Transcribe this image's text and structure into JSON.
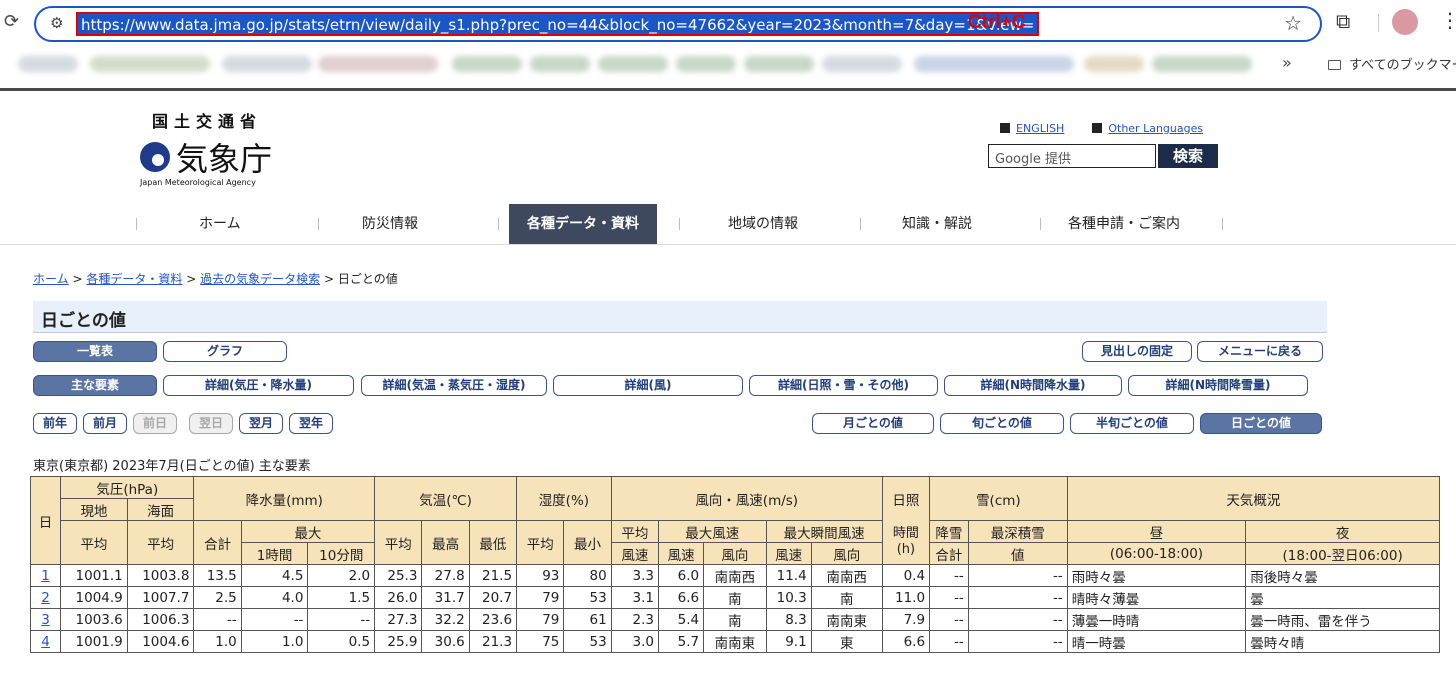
{
  "browser": {
    "url": "https://www.data.jma.go.jp/stats/etrn/view/daily_s1.php?prec_no=44&block_no=47662&year=2023&month=7&day=1&view=",
    "annotation": "Ctrl+C",
    "bookmarks_all": "すべてのブックマーク",
    "more": "»"
  },
  "header": {
    "ministry": "国土交通省",
    "agency": "気象庁",
    "agency_en": "Japan Meteorological Agency",
    "link_english": "ENGLISH",
    "link_other": "Other Languages",
    "search_placeholder": "Google 提供",
    "search_button": "検索"
  },
  "nav": [
    "ホーム",
    "防災情報",
    "各種データ・資料",
    "地域の情報",
    "知識・解説",
    "各種申請・ご案内"
  ],
  "breadcrumb": {
    "home": "ホーム",
    "sep": ">",
    "data": "各種データ・資料",
    "past": "過去の気象データ検索",
    "current": "日ごとの値"
  },
  "page_title": "日ごとの値",
  "buttons": {
    "list": "一覧表",
    "graph": "グラフ",
    "fix": "見出しの固定",
    "back": "メニューに戻る",
    "main": "主な要素",
    "detail1": "詳細(気圧・降水量)",
    "detail2": "詳細(気温・蒸気圧・湿度)",
    "detail3": "詳細(風)",
    "detail4": "詳細(日照・雪・その他)",
    "detail5": "詳細(N時間降水量)",
    "detail6": "詳細(N時間降雪量)",
    "prev_year": "前年",
    "prev_month": "前月",
    "prev_day": "前日",
    "next_day": "翌日",
    "next_month": "翌月",
    "next_year": "翌年",
    "monthly": "月ごとの値",
    "dekad": "旬ごとの値",
    "half_dekad": "半旬ごとの値",
    "daily": "日ごとの値"
  },
  "caption": "東京(東京都) 2023年7月(日ごとの値) 主な要素",
  "table": {
    "h": {
      "day": "日",
      "pressure": "気圧(hPa)",
      "local": "現地",
      "sea": "海面",
      "avg": "平均",
      "precip": "降水量(mm)",
      "total": "合計",
      "max": "最大",
      "h1": "1時間",
      "m10": "10分間",
      "temp": "気温(℃)",
      "tmax": "最高",
      "tmin": "最低",
      "humid": "湿度(%)",
      "hmin": "最小",
      "wind": "風向・風速(m/s)",
      "wavg1": "平均",
      "wavg2": "風速",
      "maxws": "最大風速",
      "maxgust": "最大瞬間風速",
      "speed": "風速",
      "dir": "風向",
      "sun1": "日照",
      "sun2": "時間",
      "sun3": "(h)",
      "snow": "雪(cm)",
      "snowfall": "降雪",
      "snowmax": "最深積雪",
      "value": "値",
      "weather": "天気概況",
      "day_w": "昼",
      "day_t": "(06:00-18:00)",
      "night_w": "夜",
      "night_t": "(18:00-翌日06:00)"
    },
    "rows": [
      {
        "d": "1",
        "p1": "1001.1",
        "p2": "1003.8",
        "pr": "13.5",
        "h1": "4.5",
        "m10": "2.0",
        "ta": "25.3",
        "tx": "27.8",
        "tn": "21.5",
        "ha": "93",
        "hn": "80",
        "wa": "3.3",
        "ws": "6.0",
        "wd": "南南西",
        "gs": "11.4",
        "gd": "南南西",
        "sun": "0.4",
        "sf": "--",
        "sd": "--",
        "wday": "雨時々曇",
        "wnight": "雨後時々曇"
      },
      {
        "d": "2",
        "p1": "1004.9",
        "p2": "1007.7",
        "pr": "2.5",
        "h1": "4.0",
        "m10": "1.5",
        "ta": "26.0",
        "tx": "31.7",
        "tn": "20.7",
        "ha": "79",
        "hn": "53",
        "wa": "3.1",
        "ws": "6.6",
        "wd": "南",
        "gs": "10.3",
        "gd": "南",
        "sun": "11.0",
        "sf": "--",
        "sd": "--",
        "wday": "晴時々薄曇",
        "wnight": "曇"
      },
      {
        "d": "3",
        "p1": "1003.6",
        "p2": "1006.3",
        "pr": "--",
        "h1": "--",
        "m10": "--",
        "ta": "27.3",
        "tx": "32.2",
        "tn": "23.6",
        "ha": "79",
        "hn": "61",
        "wa": "2.3",
        "ws": "5.4",
        "wd": "南",
        "gs": "8.3",
        "gd": "南南東",
        "sun": "7.9",
        "sf": "--",
        "sd": "--",
        "wday": "薄曇一時晴",
        "wnight": "曇一時雨、雷を伴う"
      },
      {
        "d": "4",
        "p1": "1001.9",
        "p2": "1004.6",
        "pr": "1.0",
        "h1": "1.0",
        "m10": "0.5",
        "ta": "25.9",
        "tx": "30.6",
        "tn": "21.3",
        "ha": "75",
        "hn": "53",
        "wa": "3.0",
        "ws": "5.7",
        "wd": "南南東",
        "gs": "9.1",
        "gd": "東",
        "sun": "6.6",
        "sf": "--",
        "sd": "--",
        "wday": "晴一時曇",
        "wnight": "曇時々晴"
      }
    ]
  }
}
